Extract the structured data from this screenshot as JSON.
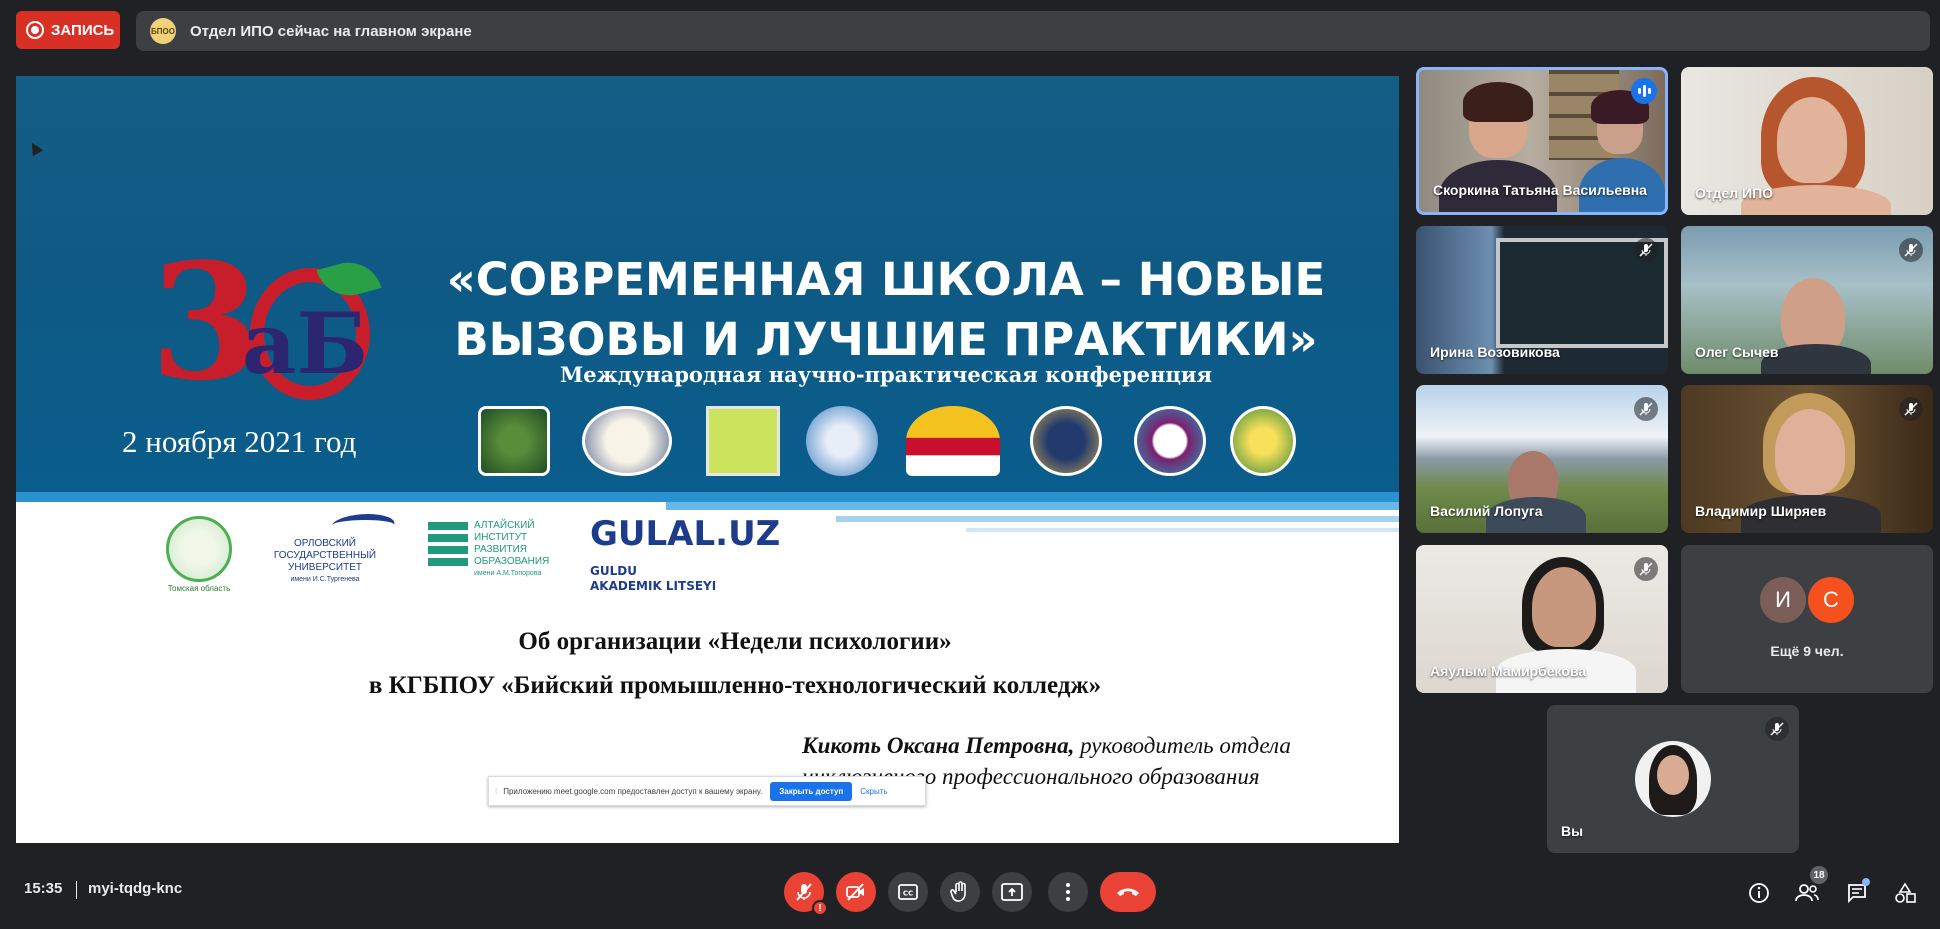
{
  "topbar": {
    "record_label": "ЗАПИСЬ",
    "banner_avatar": "БПОО",
    "banner_text": "Отдел ИПО сейчас на главном экране"
  },
  "presentation": {
    "title_line1": "«СОВРЕМЕННАЯ ШКОЛА – НОВЫЕ",
    "title_line2": "ВЫЗОВЫ И ЛУЧШИЕ ПРАКТИКИ»",
    "subtitle": "Международная научно-практическая конференция",
    "date": "2 ноября 2021 год",
    "logo_three": "3",
    "logo_ab": "аБ",
    "partner_logos": [
      "АГППУ",
      "Орловский государственный университет",
      "ИМЦ",
      "Глобус",
      "Книга",
      "СЕМЕЙ",
      "Логотип",
      "Тыва"
    ],
    "oryol_text": "ОРЛОВСКИЙ ГОСУДАРСТВЕННЫЙ УНИВЕРСИТЕТ",
    "oryol_sub": "имени И.С.Тургенева",
    "altai_text": "АЛТАЙСКИЙ ИНСТИТУТ РАЗВИТИЯ ОБРАЗОВАНИЯ",
    "altai_sub": "имени А.М.Топорова",
    "tomsk_text": "Томская область",
    "gulal_title": "GULAL.UZ",
    "gulal_sub1": "GULDU",
    "gulal_sub2": "AKADEMIK LITSEYI",
    "topic1": "Об организации «Недели психологии»",
    "topic2": "в КГБПОУ «Бийский промышленно-технологический колледж»",
    "author_name": "Кикоть Оксана Петровна,",
    "author_role": " руководитель отдела",
    "author_role2": "инклюзивного профессионального образования"
  },
  "share_bar": {
    "message": "Приложению meet.google.com предоставлен доступ к вашему экрану.",
    "stop_label": "Закрыть доступ",
    "hide_label": "Скрыть"
  },
  "participants": [
    {
      "name": "Скоркина Татьяна Васильевна",
      "muted": false,
      "speaking": true
    },
    {
      "name": "Отдел ИПО",
      "muted": false,
      "speaking": false
    },
    {
      "name": "Ирина Возовикова",
      "muted": true
    },
    {
      "name": "Олег Сычев",
      "muted": true
    },
    {
      "name": "Василий Лопуга",
      "muted": true
    },
    {
      "name": "Владимир Ширяев",
      "muted": true
    },
    {
      "name": "Аяулым Мамирбекова",
      "muted": true
    },
    {
      "name": "Вы",
      "muted": true
    }
  ],
  "more": {
    "avatars": [
      {
        "letter": "И",
        "color": "#7b5e57"
      },
      {
        "letter": "С",
        "color": "#f4511e"
      }
    ],
    "label": "Ещё 9 чел."
  },
  "bottombar": {
    "time": "15:35",
    "meeting_code": "myi-tqdg-knc",
    "people_count": "18",
    "alert_mark": "!"
  },
  "colors": {
    "background": "#202124",
    "record_red": "#d93025",
    "active_border": "#8ab4f8",
    "hangup": "#ea4335",
    "slide_blue": "#0e5a85"
  }
}
